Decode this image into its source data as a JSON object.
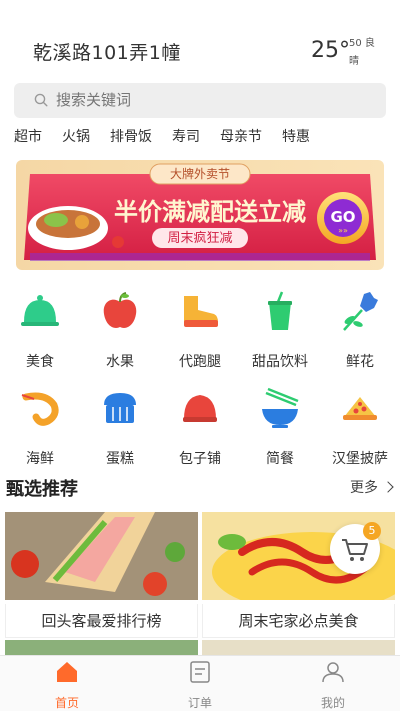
{
  "header": {
    "address": "乾溪路101弄1幢",
    "temperature": "25°",
    "aqi": "50 良",
    "weather": "晴"
  },
  "search": {
    "placeholder": "搜索关键词"
  },
  "tags": [
    "超市",
    "火锅",
    "排骨饭",
    "寿司",
    "母亲节",
    "特惠"
  ],
  "banner": {
    "badge": "大牌外卖节",
    "headline_left": "半价满减",
    "headline_right": "配送立减",
    "subline": "周末疯狂减",
    "go": "GO",
    "go_arrows": "»»"
  },
  "categories": [
    {
      "label": "美食",
      "icon": "food-cloche-icon"
    },
    {
      "label": "水果",
      "icon": "apple-icon"
    },
    {
      "label": "代跑腿",
      "icon": "running-shoe-icon"
    },
    {
      "label": "甜品饮料",
      "icon": "drink-cup-icon"
    },
    {
      "label": "鲜花",
      "icon": "rose-icon"
    },
    {
      "label": "海鲜",
      "icon": "shrimp-icon"
    },
    {
      "label": "蛋糕",
      "icon": "cake-icon"
    },
    {
      "label": "包子铺",
      "icon": "bun-icon"
    },
    {
      "label": "简餐",
      "icon": "noodle-bowl-icon"
    },
    {
      "label": "汉堡披萨",
      "icon": "pizza-icon"
    }
  ],
  "section": {
    "title": "甄选推荐",
    "more": "更多"
  },
  "cards": [
    {
      "caption": "回头客最爱排行榜"
    },
    {
      "caption": "周末宅家必点美食"
    }
  ],
  "cart": {
    "count": "5"
  },
  "tabbar": [
    {
      "label": "首页",
      "active": true
    },
    {
      "label": "订单",
      "active": false
    },
    {
      "label": "我的",
      "active": false
    }
  ],
  "colors": {
    "accent": "#ff6a2b",
    "banner_bg": "#e8304f",
    "tab_inactive": "#888888"
  }
}
